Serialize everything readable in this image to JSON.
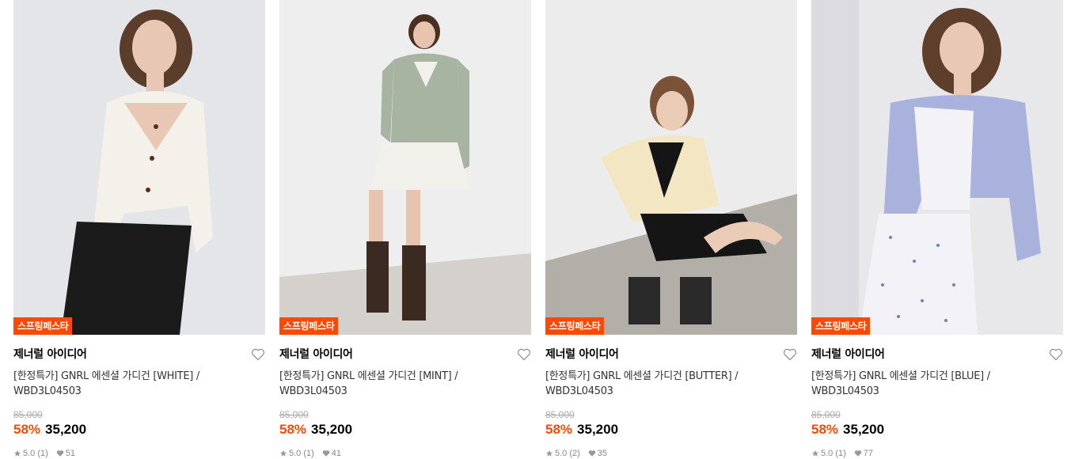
{
  "products": [
    {
      "image_alt": "white cardigan",
      "badge": "스프링페스타",
      "brand": "제너럴 아이디어",
      "title": "[한정특가] GNRL 에센셜 가디건 [WHITE] / WBD3L04503",
      "original_price": "85,000",
      "discount": "58%",
      "price": "35,200",
      "rating": "5.0 (1)",
      "likes": "51",
      "colors": {
        "bg": "#dddfe2",
        "wall": "#e4e5e8",
        "cardigan": "#f3f1ea",
        "skirt": "#1b1b1b",
        "hair": "#5a3d2a",
        "skin": "#e8c8b5"
      }
    },
    {
      "image_alt": "mint cardigan",
      "badge": "스프링페스타",
      "brand": "제너럴 아이디어",
      "title": "[한정특가] GNRL 에센셜 가디건 [MINT] / WBD3L04503",
      "original_price": "85,000",
      "discount": "58%",
      "price": "35,200",
      "rating": "5.0 (1)",
      "likes": "41",
      "colors": {
        "bg": "#ececec",
        "wall": "#eeeeee",
        "cardigan": "#a7b4a1",
        "skirt": "#f2f0ea",
        "hair": "#4a3020",
        "skin": "#e6c4b0"
      }
    },
    {
      "image_alt": "butter cardigan",
      "badge": "스프링페스타",
      "brand": "제너럴 아이디어",
      "title": "[한정특가] GNRL 에센셜 가디건 [BUTTER] / WBD3L04503",
      "original_price": "85,000",
      "discount": "58%",
      "price": "35,200",
      "rating": "5.0 (2)",
      "likes": "35",
      "colors": {
        "bg": "#e9e9e9",
        "wall": "#ececec",
        "cardigan": "#f2e6c3",
        "skirt": "#151515",
        "hair": "#7a5238",
        "skin": "#e9cbb6"
      }
    },
    {
      "image_alt": "blue cardigan",
      "badge": "스프링페스타",
      "brand": "제너럴 아이디어",
      "title": "[한정특가] GNRL 에센셜 가디건 [BLUE] / WBD3L04503",
      "original_price": "85,000",
      "discount": "58%",
      "price": "35,200",
      "rating": "5.0 (1)",
      "likes": "77",
      "colors": {
        "bg": "#e4e4e6",
        "wall": "#e8e8ea",
        "cardigan": "#a9b2dc",
        "skirt": "#f3f3f7",
        "hair": "#5e3f2b",
        "skin": "#e9c9b6"
      }
    }
  ],
  "accent": "#ff4800"
}
